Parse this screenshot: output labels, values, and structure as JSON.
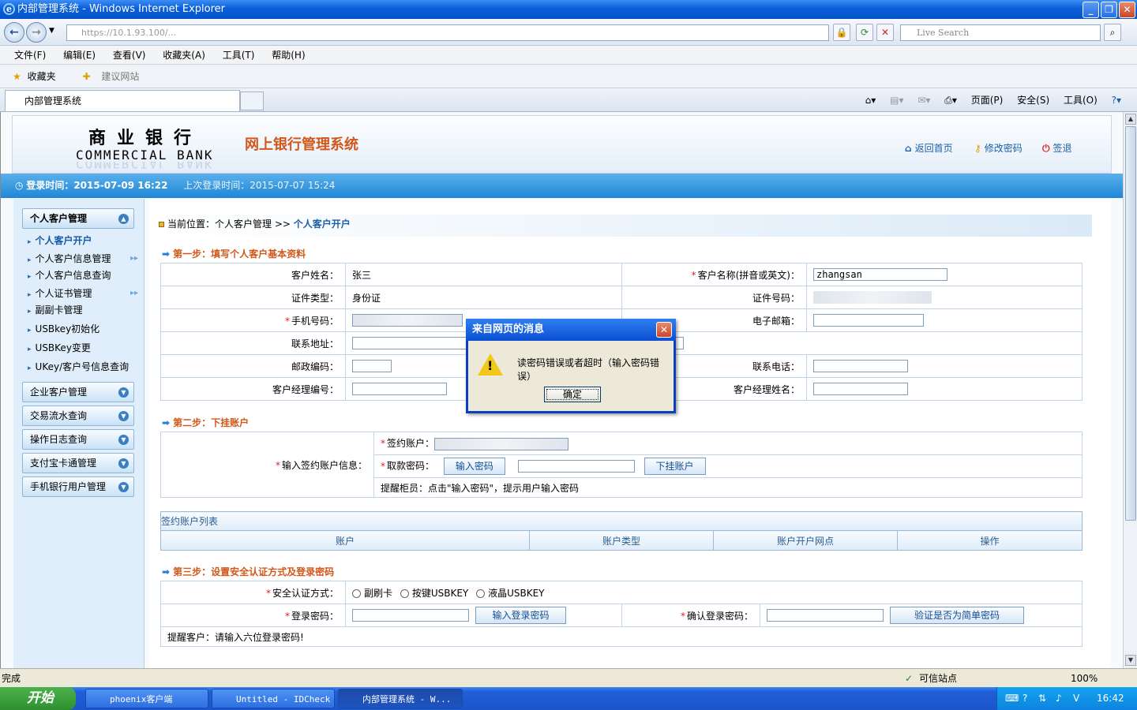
{
  "window": {
    "title": "内部管理系统 - Windows Internet Explorer"
  },
  "browser": {
    "address": "https://10.1.93.100/...",
    "search_placeholder": "Live Search",
    "menu": [
      "文件(F)",
      "编辑(E)",
      "查看(V)",
      "收藏夹(A)",
      "工具(T)",
      "帮助(H)"
    ],
    "favorites_label": "收藏夹",
    "suggested_sites": "建议网站",
    "tab_label": "内部管理系统",
    "cmd": {
      "page": "页面(P)",
      "safety": "安全(S)",
      "tools": "工具(O)"
    }
  },
  "header": {
    "logo_cn": "商业银行",
    "logo_en": "COMMERCIAL BANK",
    "system_title": "网上银行管理系统",
    "links": {
      "home": "返回首页",
      "change_pwd": "修改密码",
      "logout": "签退"
    }
  },
  "loginbar": {
    "login_time": "登录时间：2015-07-09 16:22",
    "last_login": "上次登录时间：2015-07-07 15:24"
  },
  "sidebar": {
    "group1": "个人客户管理",
    "items": [
      "个人客户开户",
      "个人客户信息管理",
      "个人客户信息查询",
      "个人证书管理",
      "副副卡管理",
      "USBkey初始化",
      "USBKey变更",
      "UKey/客户号信息查询"
    ],
    "groups": [
      "企业客户管理",
      "交易流水查询",
      "操作日志查询",
      "支付宝卡通管理",
      "手机银行用户管理"
    ]
  },
  "main": {
    "crumb_prefix": "当前位置：个人客户管理 >>",
    "crumb_current": "个人客户开户",
    "step1": "第一步：填写个人客户基本资料",
    "step1_fields": {
      "name_label": "客户姓名：",
      "name_value": "张三",
      "name_en_label": "客户名称(拼音或英文)：",
      "name_en_value": "zhangsan",
      "id_type_label": "证件类型：",
      "id_type_value": "身份证",
      "id_no_label": "证件号码：",
      "mobile_label": "手机号码：",
      "email_label": "电子邮箱：",
      "address_label": "联系地址：",
      "postcode_label": "邮政编码：",
      "phone_label": "联系电话：",
      "mgr_no_label": "客户经理编号：",
      "mgr_name_label": "客户经理姓名："
    },
    "step2": "第二步：下挂账户",
    "step2_fields": {
      "input_label": "输入签约账户信息：",
      "acct_label": "签约账户：",
      "pwd_label": "取款密码：",
      "pwd_btn": "输入密码",
      "attach_btn": "下挂账户",
      "tip": "提醒柜员：点击\"输入密码\"，提示用户输入密码"
    },
    "acct_list": {
      "title": "签约账户列表",
      "columns": [
        "账户",
        "账户类型",
        "账户开户网点",
        "操作"
      ]
    },
    "step3": "第三步：设置安全认证方式及登录密码",
    "step3_fields": {
      "auth_label": "安全认证方式：",
      "options": [
        "副刷卡",
        "按键USBKEY",
        "液晶USBKEY"
      ],
      "login_pwd_label": "登录密码：",
      "login_pwd_btn": "输入登录密码",
      "confirm_label": "确认登录密码：",
      "verify_btn": "验证是否为简单密码",
      "tip": "提醒客户：请输入六位登录密码!"
    }
  },
  "dialog": {
    "title": "来自网页的消息",
    "message": "读密码错误或者超时（输入密码错误）",
    "ok": "确定"
  },
  "statusbar": {
    "left": "完成",
    "zone": "可信站点",
    "zoom": "100%"
  },
  "taskbar": {
    "start": "开始",
    "tasks": [
      "phoenix客户端",
      "Untitled - IDCheck",
      "内部管理系统 - W..."
    ],
    "clock": "16:42"
  }
}
